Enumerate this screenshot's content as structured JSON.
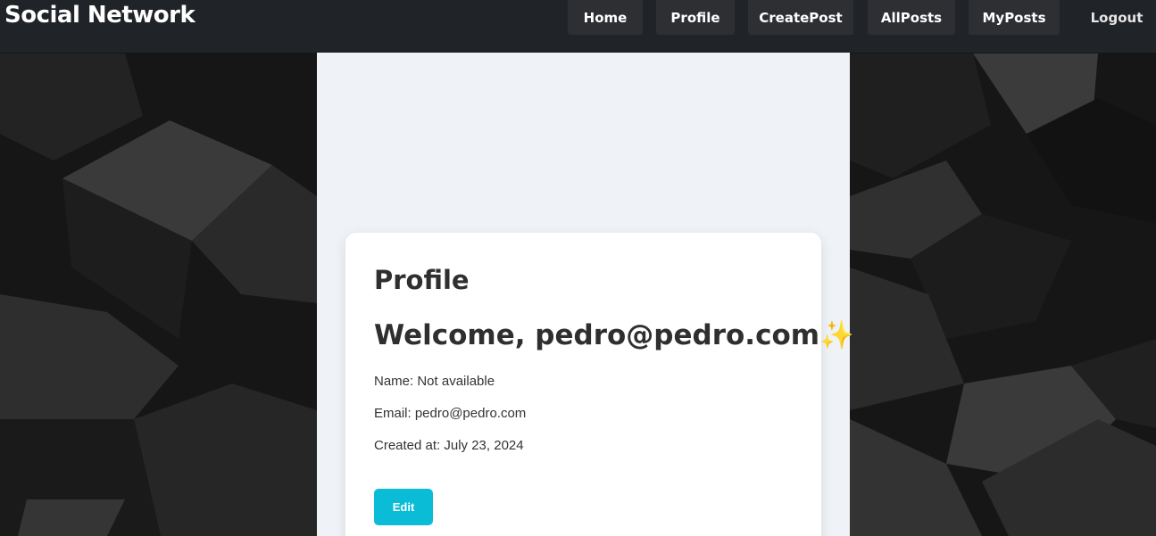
{
  "navbar": {
    "brand": "Social Network",
    "links": [
      "Home",
      "Profile",
      "CreatePost",
      "AllPosts",
      "MyPosts"
    ],
    "logout": "Logout"
  },
  "profile": {
    "title": "Profile",
    "welcome": "Welcome, pedro@pedro.com",
    "sparkle_icon": "sparkles-icon",
    "name_line": "Name: Not available",
    "email_line": "Email: pedro@pedro.com",
    "created_line": "Created at: July 23, 2024",
    "edit_label": "Edit"
  },
  "colors": {
    "navbar_bg": "#202328",
    "nav_button_bg": "#2d2f33",
    "page_bg": "#eff2f7",
    "card_bg": "#ffffff",
    "edit_button": "#0bbcd6"
  }
}
